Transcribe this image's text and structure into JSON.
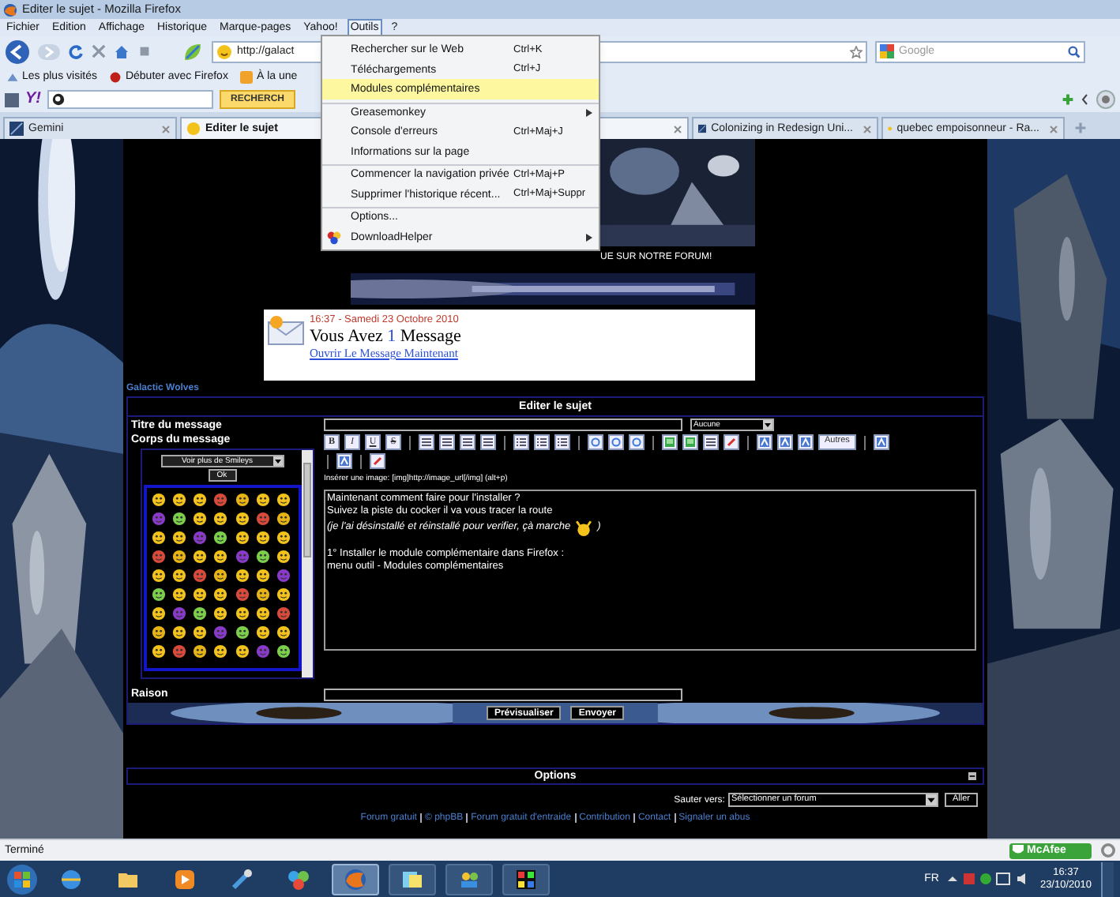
{
  "window": {
    "title": "Editer le sujet - Mozilla Firefox"
  },
  "menu_bar": [
    {
      "label": "Fichier",
      "selected": false
    },
    {
      "label": "Edition",
      "selected": false
    },
    {
      "label": "Affichage",
      "selected": false
    },
    {
      "label": "Historique",
      "selected": false
    },
    {
      "label": "Marque-pages",
      "selected": false
    },
    {
      "label": "Yahoo!",
      "selected": false
    },
    {
      "label": "Outils",
      "selected": true
    },
    {
      "label": "?",
      "selected": false
    }
  ],
  "open_menu": [
    {
      "kind": "item",
      "label": "Rechercher sur le Web",
      "shortcut": "Ctrl+K",
      "separator_before": false,
      "selected": false
    },
    {
      "kind": "item",
      "label": "Téléchargements",
      "shortcut": "Ctrl+J",
      "separator_before": false,
      "selected": false
    },
    {
      "kind": "item",
      "label": "Modules complémentaires",
      "separator_before": false,
      "selected": true
    },
    {
      "kind": "submenu",
      "label": "Greasemonkey",
      "separator_before": true,
      "selected": false
    },
    {
      "kind": "item",
      "label": "Console d'erreurs",
      "shortcut": "Ctrl+Maj+J",
      "separator_before": false,
      "selected": false
    },
    {
      "kind": "item",
      "label": "Informations sur la page",
      "separator_before": false,
      "selected": false
    },
    {
      "kind": "item",
      "label": "Commencer la navigation privée",
      "shortcut": "Ctrl+Maj+P",
      "separator_before": true,
      "selected": false
    },
    {
      "kind": "item",
      "label": "Supprimer l'historique récent...",
      "shortcut": "Ctrl+Maj+Suppr",
      "separator_before": false,
      "selected": false
    },
    {
      "kind": "item",
      "label": "Options...",
      "separator_before": true,
      "selected": false
    },
    {
      "kind": "icon-submenu",
      "label": "DownloadHelper",
      "separator_before": false,
      "selected": false
    }
  ],
  "nav": {
    "url": "http://galact",
    "search_placeholder": "Google"
  },
  "bookmarks": [
    "Les plus visités",
    "Débuter avec Firefox",
    "À la une"
  ],
  "yahoo_toolbar": {
    "logo": "Y!",
    "search_button": "RECHERCH"
  },
  "tabs": [
    {
      "label": "Gemini",
      "selected": false
    },
    {
      "label": "Editer le sujet",
      "selected": true
    },
    {
      "label": "Colonizing in Redesign Uni...",
      "selected": false
    },
    {
      "label": "quebec empoisonneur - Ra...",
      "selected": false
    }
  ],
  "page": {
    "banner_caption": "UE SUR NOTRE FORUM!",
    "notification": {
      "time": "16:37 - Samedi 23 Octobre 2010",
      "message_parts": [
        "Vous Avez ",
        "1",
        " Message"
      ],
      "link": "Ouvrir Le Message Maintenant"
    },
    "breadcrumb": "Galactic Wolves",
    "form": {
      "title": "Editer le sujet",
      "subject_label": "Titre du message",
      "icon_select": "Aucune",
      "body_label": "Corps du message",
      "smiley_select": "Voir plus de Smileys",
      "smiley_ok": "Ok",
      "text_tools": [
        "B",
        "I",
        "U",
        "S"
      ],
      "more_tools": "Autres",
      "hint": "Insérer une image: [img]http://image_url[/img] (alt+p)",
      "body": [
        {
          "kind": "text",
          "text": "Maintenant comment faire pour l'installer ?"
        },
        {
          "kind": "text",
          "text": "Suivez la piste du cocker il va vous tracer la route"
        },
        {
          "kind": "italic-smiley",
          "text": "(je l'ai désinstallé et réinstallé pour verifier, çà marche",
          "after": ")"
        },
        {
          "kind": "blank"
        },
        {
          "kind": "text",
          "text": "1° Installer le module complémentaire dans Firefox :"
        },
        {
          "kind": "text",
          "text": "menu outil - Modules complémentaires"
        }
      ],
      "reason_label": "Raison",
      "buttons": [
        "Prévisualiser",
        "Envoyer"
      ]
    },
    "options": "Options",
    "jump_label": "Sauter vers:",
    "jump_select": "Sélectionner un forum",
    "jump_button": "Aller",
    "footer_links": [
      "Forum gratuit",
      "© phpBB",
      "Forum gratuit d'entraide",
      "Contribution",
      "Contact",
      "Signaler un abus"
    ]
  },
  "status_bar": {
    "text": "Terminé",
    "badge": "McAfee"
  },
  "taskbar": {
    "apps": [
      {
        "kind": "globe",
        "selected": false
      },
      {
        "kind": "folder",
        "selected": false
      },
      {
        "kind": "play",
        "selected": false
      },
      {
        "kind": "tools",
        "selected": false
      },
      {
        "kind": "shapes",
        "selected": false
      },
      {
        "kind": "fox",
        "selected": true
      },
      {
        "kind": "notes",
        "selected": false
      },
      {
        "kind": "network",
        "selected": false
      },
      {
        "kind": "grid",
        "selected": false
      }
    ],
    "language": "FR",
    "time": "16:37",
    "date": "23/10/2010"
  }
}
